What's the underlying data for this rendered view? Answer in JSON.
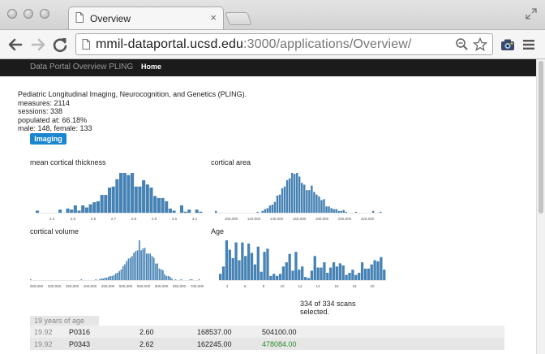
{
  "browser": {
    "tab_title": "Overview",
    "tab_close": "×",
    "url_host": "mmil-dataportal.ucsd.edu",
    "url_path": ":3000/applications/Overview/"
  },
  "nav": {
    "brand": "Data Portal Overview PLING",
    "home": "Home"
  },
  "summary": {
    "title": "Pediatric Longitudinal Imaging, Neurocognition, and Genetics (PLING).",
    "measures": "measures: 2114",
    "sessions": "sessions: 338",
    "populated": "populated at: 66.18%",
    "sex": "male: 148, female: 133",
    "badge": "Imaging"
  },
  "selection": "334 of 334 scans selected.",
  "table": {
    "group_header": "19 years of age",
    "rows": [
      {
        "age": "19.92",
        "id": "P0316",
        "a": "2.60",
        "b": "168537.00",
        "c": "504100.00",
        "hl": false
      },
      {
        "age": "19.92",
        "id": "P0343",
        "a": "2.62",
        "b": "162245.00",
        "c": "478084.00",
        "hl": true
      }
    ]
  },
  "chart_data": [
    {
      "type": "bar",
      "title": "mean cortical thickness",
      "x_ticks": [
        "2.4",
        "2.5",
        "2.6",
        "2.7",
        "2.8",
        "2.9",
        "3.0",
        "3.1"
      ],
      "values": [
        2,
        0,
        0,
        0,
        0,
        0,
        3,
        0,
        4,
        3,
        7,
        2,
        7,
        5,
        8,
        10,
        11,
        17,
        17,
        24,
        25,
        32,
        38,
        38,
        36,
        38,
        25,
        25,
        31,
        27,
        24,
        16,
        14,
        14,
        11,
        4,
        2,
        0,
        7,
        1,
        3,
        0,
        3,
        1
      ]
    },
    {
      "type": "bar",
      "title": "cortical area",
      "x_ticks": [
        "100,000",
        "120,000",
        "140,000",
        "160,000",
        "180,000",
        "200,000",
        "220,000"
      ],
      "values": [
        2,
        0,
        0,
        0,
        0,
        0,
        0,
        0,
        0,
        0,
        0,
        0,
        0,
        0,
        0,
        0,
        0,
        1,
        0,
        2,
        4,
        5,
        8,
        9,
        12,
        19,
        20,
        27,
        29,
        36,
        38,
        44,
        43,
        44,
        40,
        33,
        31,
        25,
        25,
        30,
        23,
        20,
        18,
        14,
        15,
        7,
        7,
        5,
        4,
        4,
        2,
        2,
        3,
        1,
        0,
        0,
        0,
        1,
        0,
        0,
        0,
        0,
        0,
        0,
        2,
        0,
        0,
        1
      ]
    },
    {
      "type": "bar",
      "title": "cortical volume",
      "x_ticks": [
        "250,000",
        "300,000",
        "350,000",
        "400,000",
        "450,000",
        "500,000",
        "550,000",
        "600,000",
        "650,000",
        "700,000"
      ],
      "values": [
        1,
        0,
        0,
        0,
        0,
        0,
        0,
        0,
        0,
        0,
        0,
        0,
        0,
        0,
        0,
        0,
        0,
        0,
        0,
        0,
        0,
        0,
        0,
        0,
        0,
        0,
        0,
        0,
        1,
        0,
        0,
        0,
        0,
        0,
        0,
        0,
        1,
        0,
        1,
        2,
        2,
        3,
        3,
        4,
        5,
        5,
        6,
        8,
        9,
        11,
        13,
        17,
        19,
        23,
        26,
        27,
        29,
        33,
        35,
        36,
        48,
        36,
        38,
        39,
        32,
        32,
        32,
        29,
        27,
        20,
        20,
        14,
        13,
        12,
        7,
        5,
        5,
        4,
        2,
        0,
        1,
        0,
        0,
        1,
        0,
        0,
        0,
        0,
        1,
        1,
        0,
        0,
        0,
        1
      ]
    },
    {
      "type": "bar",
      "title": "Age",
      "x_ticks": [
        "4",
        "6",
        "8",
        "10",
        "12",
        "14",
        "16",
        "18",
        "20"
      ],
      "values": [
        6,
        13,
        38,
        29,
        21,
        36,
        19,
        36,
        23,
        35,
        26,
        15,
        32,
        8,
        27,
        30,
        4,
        6,
        4,
        6,
        13,
        17,
        25,
        9,
        27,
        10,
        13,
        3,
        2,
        9,
        23,
        12,
        12,
        17,
        7,
        12,
        17,
        13,
        16,
        14,
        5,
        7,
        10,
        5,
        7,
        17,
        11,
        11,
        15,
        19,
        18,
        22,
        10
      ]
    }
  ]
}
